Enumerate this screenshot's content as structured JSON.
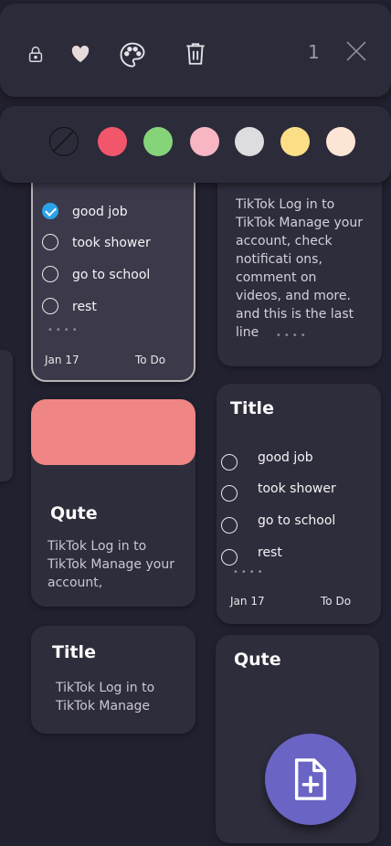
{
  "toolbar": {
    "count": "1",
    "icons": [
      "lock-icon",
      "heart-icon",
      "palette-icon",
      "trash-icon",
      "close-icon"
    ]
  },
  "palette": {
    "colors": [
      "none",
      "#f2566a",
      "#86d47a",
      "#f7b6c2",
      "#dddddf",
      "#fcde86",
      "#fde5d6"
    ]
  },
  "note1": {
    "items": [
      "good job",
      "took shower",
      "go to school",
      "rest"
    ],
    "checked": [
      true,
      false,
      false,
      false
    ],
    "date": "Jan 17",
    "status": "To Do"
  },
  "note2": {
    "body": "TikTok Log in to TikTok Manage your account, check notificati ons, comment on videos, and more. and this is the last line"
  },
  "note3": {
    "title": "Qute",
    "body": "TikTok Log in to TikTok Manage your account,",
    "header_color": "#f08585"
  },
  "note4": {
    "title": "Title",
    "items": [
      "good job",
      "took shower",
      "go to school",
      "rest"
    ],
    "date": "Jan 17",
    "status": "To Do"
  },
  "note5": {
    "title": "Title",
    "body": "TikTok Log in to TikTok Manage"
  },
  "note6": {
    "title": "Qute"
  },
  "fab": {
    "icon": "add-note-icon"
  }
}
